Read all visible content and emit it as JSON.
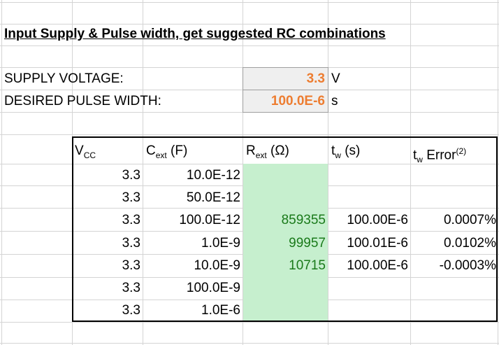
{
  "title": "Input Supply & Pulse width, get suggested RC combinations",
  "supply": {
    "label": "SUPPLY VOLTAGE:",
    "value": "3.3",
    "unit": "V"
  },
  "pulse": {
    "label": "DESIRED PULSE WIDTH:",
    "value": "100.0E-6",
    "unit": "s"
  },
  "headers": {
    "vcc_main": "V",
    "vcc_sub": "CC",
    "cext_main": "C",
    "cext_sub": "ext",
    "cext_unit": " (F)",
    "rext_main": "R",
    "rext_sub": "ext",
    "rext_unit": " (Ω)",
    "tw_main": "t",
    "tw_sub": "w",
    "tw_unit": " (s)",
    "twerr_main": "t",
    "twerr_sub": "w",
    "twerr_unit": " Error",
    "twerr_sup": "(2)"
  },
  "rows": [
    {
      "vcc": "3.3",
      "cext": "10.0E-12",
      "rext": "",
      "tw": "",
      "err": ""
    },
    {
      "vcc": "3.3",
      "cext": "50.0E-12",
      "rext": "",
      "tw": "",
      "err": ""
    },
    {
      "vcc": "3.3",
      "cext": "100.0E-12",
      "rext": "859355",
      "tw": "100.00E-6",
      "err": "0.0007%"
    },
    {
      "vcc": "3.3",
      "cext": "1.0E-9",
      "rext": "99957",
      "tw": "100.01E-6",
      "err": "0.0102%"
    },
    {
      "vcc": "3.3",
      "cext": "10.0E-9",
      "rext": "10715",
      "tw": "100.00E-6",
      "err": "-0.0003%"
    },
    {
      "vcc": "3.3",
      "cext": "100.0E-9",
      "rext": "",
      "tw": "",
      "err": ""
    },
    {
      "vcc": "3.3",
      "cext": "1.0E-6",
      "rext": "",
      "tw": "",
      "err": ""
    }
  ],
  "colors": {
    "accent_orange": "#ed7d31",
    "result_green": "#1a7a1a",
    "fill_green": "#c6efce"
  }
}
